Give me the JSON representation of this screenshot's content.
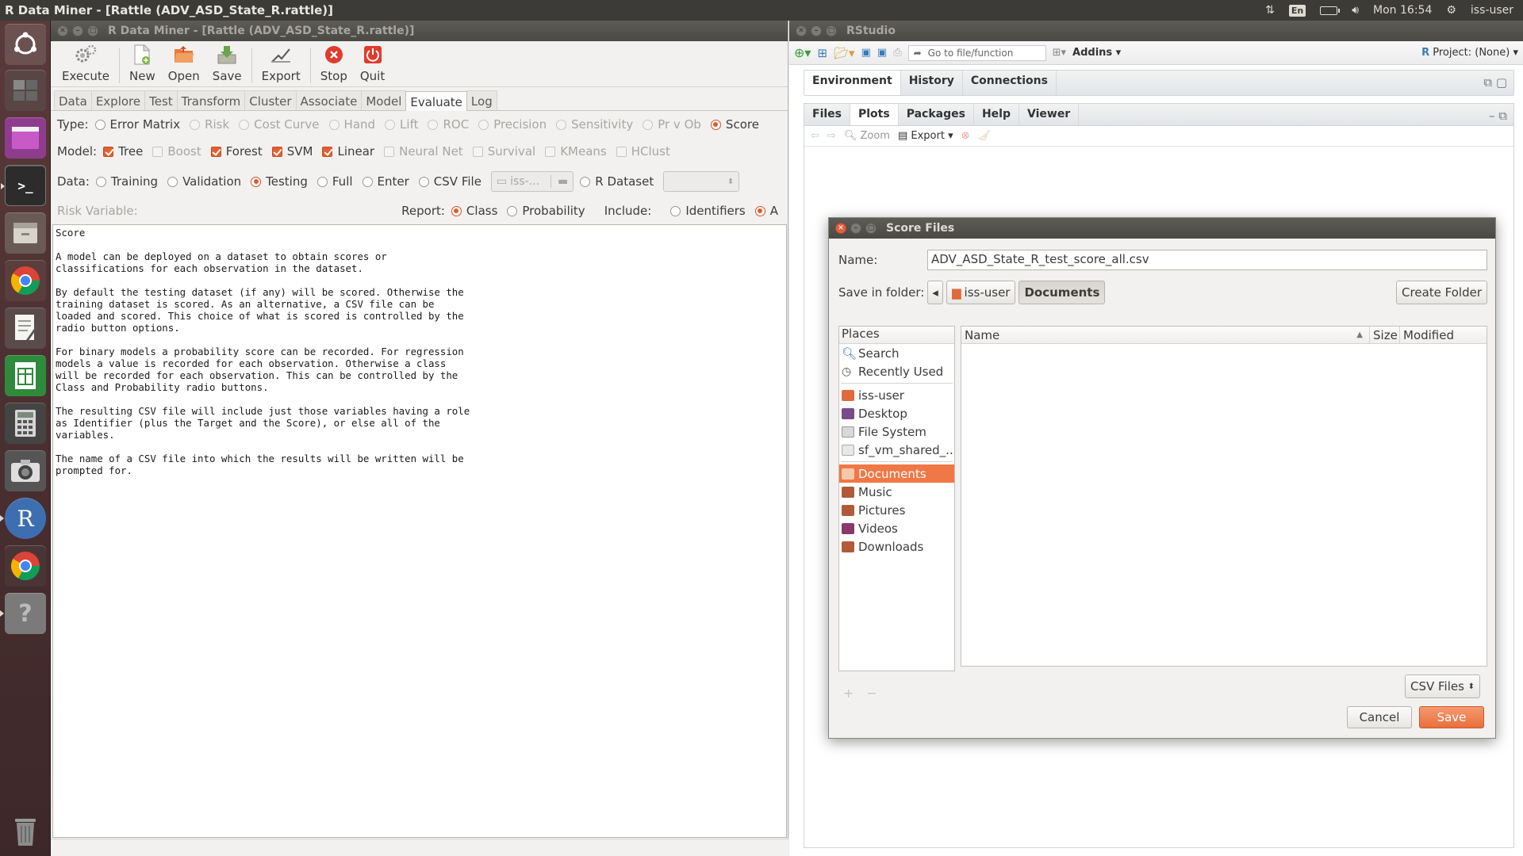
{
  "topbar": {
    "title": "R Data Miner - [Rattle (ADV_ASD_State_R.rattle)]",
    "keyboard": "En",
    "clock": "Mon 16:54",
    "user": "iss-user"
  },
  "launcher": {
    "items": [
      "ubuntu-dash",
      "workspace-switcher",
      "software-center",
      "terminal",
      "files",
      "chrome",
      "text-editor",
      "spreadsheet",
      "calculator",
      "camera",
      "r-app",
      "chrome-2",
      "help",
      "trash"
    ]
  },
  "rattle": {
    "title": "R Data Miner - [Rattle (ADV_ASD_State_R.rattle)]",
    "toolbar": {
      "execute": "Execute",
      "new": "New",
      "open": "Open",
      "save": "Save",
      "export": "Export",
      "stop": "Stop",
      "quit": "Quit"
    },
    "tabs": [
      "Data",
      "Explore",
      "Test",
      "Transform",
      "Cluster",
      "Associate",
      "Model",
      "Evaluate",
      "Log"
    ],
    "active_tab": "Evaluate",
    "type": {
      "label": "Type:",
      "options": [
        "Error Matrix",
        "Risk",
        "Cost Curve",
        "Hand",
        "Lift",
        "ROC",
        "Precision",
        "Sensitivity",
        "Pr v Ob",
        "Score"
      ]
    },
    "model": {
      "label": "Model:",
      "options": [
        "Tree",
        "Boost",
        "Forest",
        "SVM",
        "Linear",
        "Neural Net",
        "Survival",
        "KMeans",
        "HClust"
      ]
    },
    "data": {
      "label": "Data:",
      "options": [
        "Training",
        "Validation",
        "Testing",
        "Full",
        "Enter",
        "CSV File"
      ],
      "csv_combo": "iss-...",
      "rdataset": "R Dataset"
    },
    "risk_label": "Risk Variable:",
    "report": {
      "label": "Report:",
      "class": "Class",
      "probability": "Probability"
    },
    "include": {
      "label": "Include:",
      "identifiers": "Identifiers",
      "all": "A"
    },
    "text": "Score\n\nA model can be deployed on a dataset to obtain scores or\nclassifications for each observation in the dataset.\n\nBy default the testing dataset (if any) will be scored. Otherwise the\ntraining dataset is scored. As an alternative, a CSV file can be\nloaded and scored. This choice of what is scored is controlled by the\nradio button options.\n\nFor binary models a probability score can be recorded. For regression\nmodels a value is recorded for each observation. Otherwise a class\nwill be recorded for each observation. This can be controlled by the\nClass and Probability radio buttons.\n\nThe resulting CSV file will include just those variables having a role\nas Identifier (plus the Target and the Score), or else all of the\nvariables.\n\nThe name of a CSV file into which the results will be written will be\nprompted for."
  },
  "rstudio": {
    "title": "RStudio",
    "goto_placeholder": "Go to file/function",
    "addins": "Addins",
    "project": "Project: (None)",
    "top_tabs": [
      "Environment",
      "History",
      "Connections"
    ],
    "bottom_tabs": [
      "Files",
      "Plots",
      "Packages",
      "Help",
      "Viewer"
    ],
    "zoom": "Zoom",
    "export": "Export"
  },
  "dialog": {
    "title": "Score Files",
    "name_label": "Name:",
    "name_value": "ADV_ASD_State_R_test_score_all.csv",
    "folder_label": "Save in folder:",
    "crumb_user": "iss-user",
    "crumb_docs": "Documents",
    "create_folder": "Create Folder",
    "places_header": "Places",
    "places": [
      "Search",
      "Recently Used",
      "iss-user",
      "Desktop",
      "File System",
      "sf_vm_shared_...",
      "Documents",
      "Music",
      "Pictures",
      "Videos",
      "Downloads"
    ],
    "cols": {
      "name": "Name",
      "size": "Size",
      "modified": "Modified"
    },
    "filter": "CSV Files",
    "cancel": "Cancel",
    "save": "Save"
  },
  "colors": {
    "accent": "#e9642f",
    "topbar": "#3c3b37",
    "launcher": "#4a2f30"
  }
}
